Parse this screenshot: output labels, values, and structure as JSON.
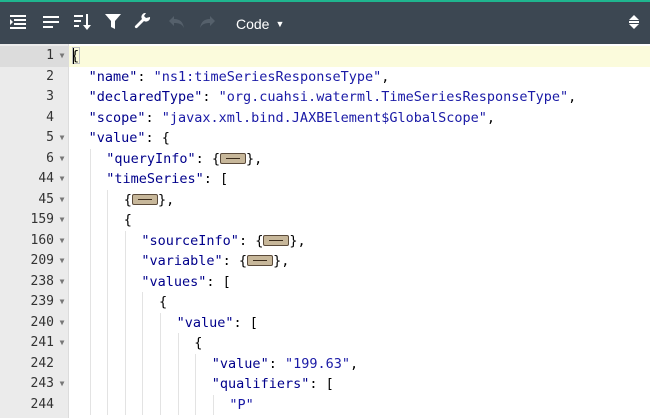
{
  "toolbar": {
    "mode_label": "Code",
    "icons": [
      "format-icon",
      "compact-icon",
      "sort-icon",
      "filter-icon",
      "repair-icon",
      "undo-icon",
      "redo-icon",
      "fullscreen-icon"
    ]
  },
  "editor": {
    "lines": [
      {
        "n": "1",
        "fold": true,
        "indent": 0,
        "tokens": [
          {
            "t": "p",
            "v": "{"
          }
        ]
      },
      {
        "n": "2",
        "fold": false,
        "indent": 1,
        "tokens": [
          {
            "t": "k",
            "v": "\"name\""
          },
          {
            "t": "p",
            "v": ": "
          },
          {
            "t": "s",
            "v": "\"ns1:timeSeriesResponseType\""
          },
          {
            "t": "p",
            "v": ","
          }
        ]
      },
      {
        "n": "3",
        "fold": false,
        "indent": 1,
        "tokens": [
          {
            "t": "k",
            "v": "\"declaredType\""
          },
          {
            "t": "p",
            "v": ": "
          },
          {
            "t": "s",
            "v": "\"org.cuahsi.waterml.TimeSeriesResponseType\""
          },
          {
            "t": "p",
            "v": ","
          }
        ]
      },
      {
        "n": "4",
        "fold": false,
        "indent": 1,
        "tokens": [
          {
            "t": "k",
            "v": "\"scope\""
          },
          {
            "t": "p",
            "v": ": "
          },
          {
            "t": "s",
            "v": "\"javax.xml.bind.JAXBElement$GlobalScope\""
          },
          {
            "t": "p",
            "v": ","
          }
        ]
      },
      {
        "n": "5",
        "fold": true,
        "indent": 1,
        "tokens": [
          {
            "t": "k",
            "v": "\"value\""
          },
          {
            "t": "p",
            "v": ": {"
          }
        ]
      },
      {
        "n": "6",
        "fold": true,
        "indent": 2,
        "tokens": [
          {
            "t": "k",
            "v": "\"queryInfo\""
          },
          {
            "t": "p",
            "v": ": {"
          },
          {
            "t": "w",
            "v": ""
          },
          {
            "t": "p",
            "v": "},"
          }
        ]
      },
      {
        "n": "44",
        "fold": true,
        "indent": 2,
        "tokens": [
          {
            "t": "k",
            "v": "\"timeSeries\""
          },
          {
            "t": "p",
            "v": ": ["
          }
        ]
      },
      {
        "n": "45",
        "fold": true,
        "indent": 3,
        "tokens": [
          {
            "t": "p",
            "v": "{"
          },
          {
            "t": "w",
            "v": ""
          },
          {
            "t": "p",
            "v": "},"
          }
        ]
      },
      {
        "n": "159",
        "fold": true,
        "indent": 3,
        "tokens": [
          {
            "t": "p",
            "v": "{"
          }
        ]
      },
      {
        "n": "160",
        "fold": true,
        "indent": 4,
        "tokens": [
          {
            "t": "k",
            "v": "\"sourceInfo\""
          },
          {
            "t": "p",
            "v": ": {"
          },
          {
            "t": "w",
            "v": ""
          },
          {
            "t": "p",
            "v": "},"
          }
        ]
      },
      {
        "n": "209",
        "fold": true,
        "indent": 4,
        "tokens": [
          {
            "t": "k",
            "v": "\"variable\""
          },
          {
            "t": "p",
            "v": ": {"
          },
          {
            "t": "w",
            "v": ""
          },
          {
            "t": "p",
            "v": "},"
          }
        ]
      },
      {
        "n": "238",
        "fold": true,
        "indent": 4,
        "tokens": [
          {
            "t": "k",
            "v": "\"values\""
          },
          {
            "t": "p",
            "v": ": ["
          }
        ]
      },
      {
        "n": "239",
        "fold": true,
        "indent": 5,
        "tokens": [
          {
            "t": "p",
            "v": "{"
          }
        ]
      },
      {
        "n": "240",
        "fold": true,
        "indent": 6,
        "tokens": [
          {
            "t": "k",
            "v": "\"value\""
          },
          {
            "t": "p",
            "v": ": ["
          }
        ]
      },
      {
        "n": "241",
        "fold": true,
        "indent": 7,
        "tokens": [
          {
            "t": "p",
            "v": "{"
          }
        ]
      },
      {
        "n": "242",
        "fold": false,
        "indent": 8,
        "tokens": [
          {
            "t": "k",
            "v": "\"value\""
          },
          {
            "t": "p",
            "v": ": "
          },
          {
            "t": "s",
            "v": "\"199.63\""
          },
          {
            "t": "p",
            "v": ","
          }
        ]
      },
      {
        "n": "243",
        "fold": true,
        "indent": 8,
        "tokens": [
          {
            "t": "k",
            "v": "\"qualifiers\""
          },
          {
            "t": "p",
            "v": ": ["
          }
        ]
      },
      {
        "n": "244",
        "fold": false,
        "indent": 9,
        "tokens": [
          {
            "t": "s",
            "v": "\"P\""
          }
        ]
      }
    ]
  },
  "colors": {
    "toolbar_bg": "#3c4752",
    "frame_accent": "#1fb58f",
    "key": "#00008b",
    "string": "#1a1aa6",
    "gutter_bg": "#ebebeb",
    "active_line": "#fbfbdc"
  }
}
